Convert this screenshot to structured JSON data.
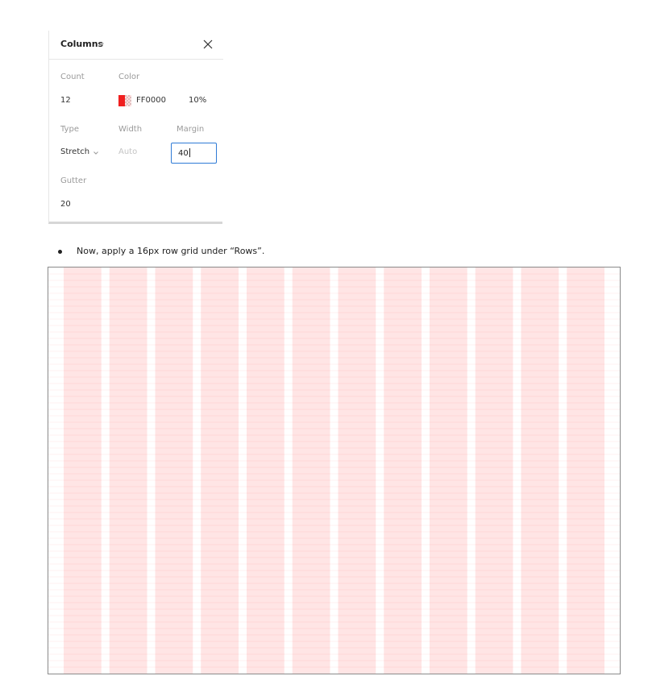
{
  "panel": {
    "title": "Columns",
    "title_icon": "chevron-down-icon",
    "close_icon": "close-icon",
    "labels": {
      "count": "Count",
      "color": "Color",
      "type": "Type",
      "width": "Width",
      "margin": "Margin",
      "gutter": "Gutter"
    },
    "values": {
      "count": "12",
      "color_hex": "FF0000",
      "opacity": "10%",
      "type": "Stretch",
      "width_placeholder": "Auto",
      "margin": "40",
      "gutter": "20"
    },
    "swatch_color": "#FF0000"
  },
  "instruction": {
    "text": "Now, apply a 16px row grid under “Rows”."
  },
  "preview": {
    "column_count": 12,
    "column_color": "#FF0000",
    "column_opacity": 0.1,
    "row_size": 16,
    "row_line_color": "#FF0000"
  }
}
